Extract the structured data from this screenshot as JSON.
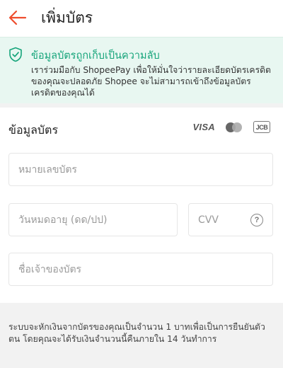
{
  "header": {
    "title": "เพิ่มบัตร",
    "back_icon": "arrow-left-icon",
    "accent_color": "#ee4d2d"
  },
  "security_banner": {
    "icon": "shield-check-icon",
    "title": "ข้อมูลบัตรถูกเก็บเป็นความลับ",
    "description": "เราร่วมมือกับ ShopeePay เพื่อให้มั่นใจว่ารายละเอียดบัตรเครดิตของคุณจะปลอดภัย Shopee จะไม่สามารถเข้าถึงข้อมูลบัตรเครดิตของคุณได้",
    "title_color": "#15a47a",
    "background_color": "#e8f7f1"
  },
  "card_info": {
    "section_title": "ข้อมูลบัตร",
    "brands": [
      "VISA",
      "Mastercard",
      "JCB"
    ],
    "visa_label": "VISA",
    "jcb_label": "JCB",
    "fields": {
      "card_number_placeholder": "หมายเลขบัตร",
      "expiry_placeholder": "วันหมดอายุ (ดด/ปป)",
      "cvv_placeholder": "CVV",
      "cardholder_placeholder": "ชื่อเจ้าของบัตร"
    },
    "cvv_help_icon": "question-circle-icon"
  },
  "footer_note": "ระบบจะหักเงินจากบัตรของคุณเป็นจำนวน 1 บาทเพื่อเป็นการยืนยันตัวตน โดยคุณจะได้รับเงินจำนวนนี้คืนภายใน 14 วันทำการ"
}
